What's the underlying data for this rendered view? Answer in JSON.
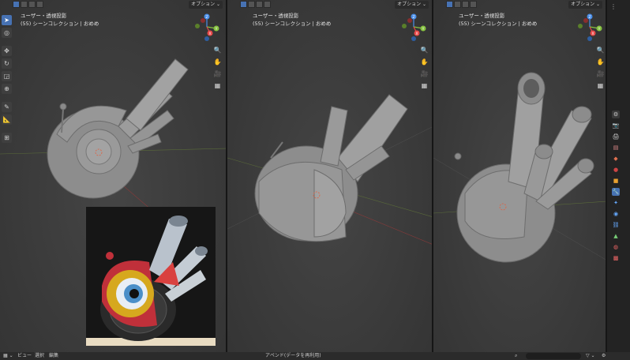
{
  "viewports": [
    {
      "info_line1": "ユーザー・透視投影",
      "info_line2": "(55) シーンコレクション | おめめ",
      "options_label": "オプション ⌄"
    },
    {
      "info_line1": "ユーザー・透視投影",
      "info_line2": "(55) シーンコレクション | おめめ",
      "options_label": "オプション ⌄"
    },
    {
      "info_line1": "ユーザー・透視投影",
      "info_line2": "(55) シーンコレクション | おめめ",
      "options_label": "オプション ⌄"
    }
  ],
  "gizmo": {
    "z": "Z",
    "y": "Y",
    "x": "X"
  },
  "bottom_bar": {
    "view": "ビュー",
    "select": "選択",
    "edit": "編集",
    "append": "アペンド(データを再利用)"
  },
  "colors": {
    "x_axis": "#e84a4a",
    "y_axis": "#86c240",
    "z_axis": "#4a8ee8",
    "active_tool": "#4772b3",
    "model": "#8a8a8a"
  },
  "icons": {
    "select_box": "select-box-icon",
    "cursor": "cursor-icon",
    "move": "move-icon",
    "rotate": "rotate-icon",
    "scale": "scale-icon",
    "transform": "transform-icon",
    "annotate": "annotate-icon",
    "measure": "measure-icon",
    "add_cube": "add-cube-icon",
    "zoom": "zoom-icon",
    "hand": "hand-icon",
    "camera": "camera-icon",
    "grid": "grid-icon"
  }
}
